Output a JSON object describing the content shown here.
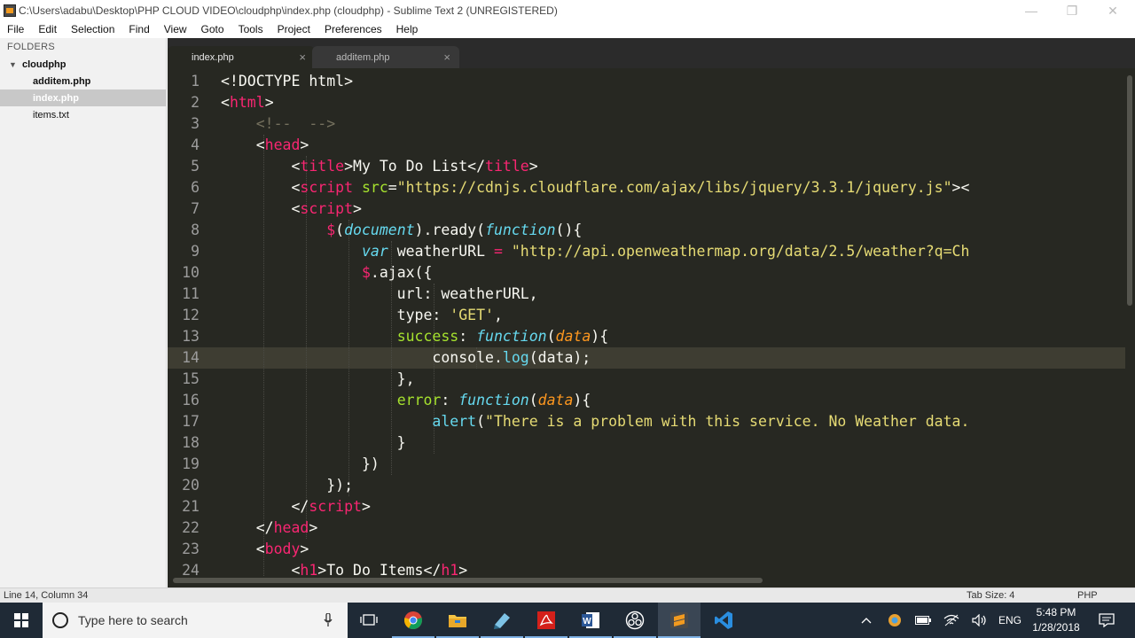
{
  "window": {
    "title": "C:\\Users\\adabu\\Desktop\\PHP CLOUD VIDEO\\cloudphp\\index.php (cloudphp) - Sublime Text 2 (UNREGISTERED)"
  },
  "menu": [
    "File",
    "Edit",
    "Selection",
    "Find",
    "View",
    "Goto",
    "Tools",
    "Project",
    "Preferences",
    "Help"
  ],
  "sidebar": {
    "header": "FOLDERS",
    "folder": "cloudphp",
    "files": [
      "additem.php",
      "index.php",
      "items.txt"
    ]
  },
  "tabs": [
    {
      "label": "index.php",
      "close": "×"
    },
    {
      "label": "additem.php",
      "close": "×"
    }
  ],
  "editor": {
    "line_numbers": [
      "1",
      "2",
      "3",
      "4",
      "5",
      "6",
      "7",
      "8",
      "9",
      "10",
      "11",
      "12",
      "13",
      "14",
      "15",
      "16",
      "17",
      "18",
      "19",
      "20",
      "21",
      "22",
      "23",
      "24"
    ],
    "current_line": 14
  },
  "status": {
    "position": "Line 14, Column 34",
    "tab_size": "Tab Size: 4",
    "syntax": "PHP"
  },
  "taskbar": {
    "search_placeholder": "Type here to search",
    "language": "ENG",
    "time": "5:48 PM",
    "date": "1/28/2018",
    "icons": [
      "windows-start-icon",
      "task-view-icon",
      "chrome-icon",
      "file-explorer-icon",
      "notepad-icon",
      "acrobat-icon",
      "word-icon",
      "obs-icon",
      "sublime-icon",
      "vscode-icon"
    ]
  },
  "colors": {
    "editor_bg": "#272822",
    "tag": "#f92672",
    "string": "#e6db74",
    "keyword": "#66d9ef",
    "function": "#a6e22e",
    "param": "#fd971f",
    "comment": "#75715e"
  }
}
